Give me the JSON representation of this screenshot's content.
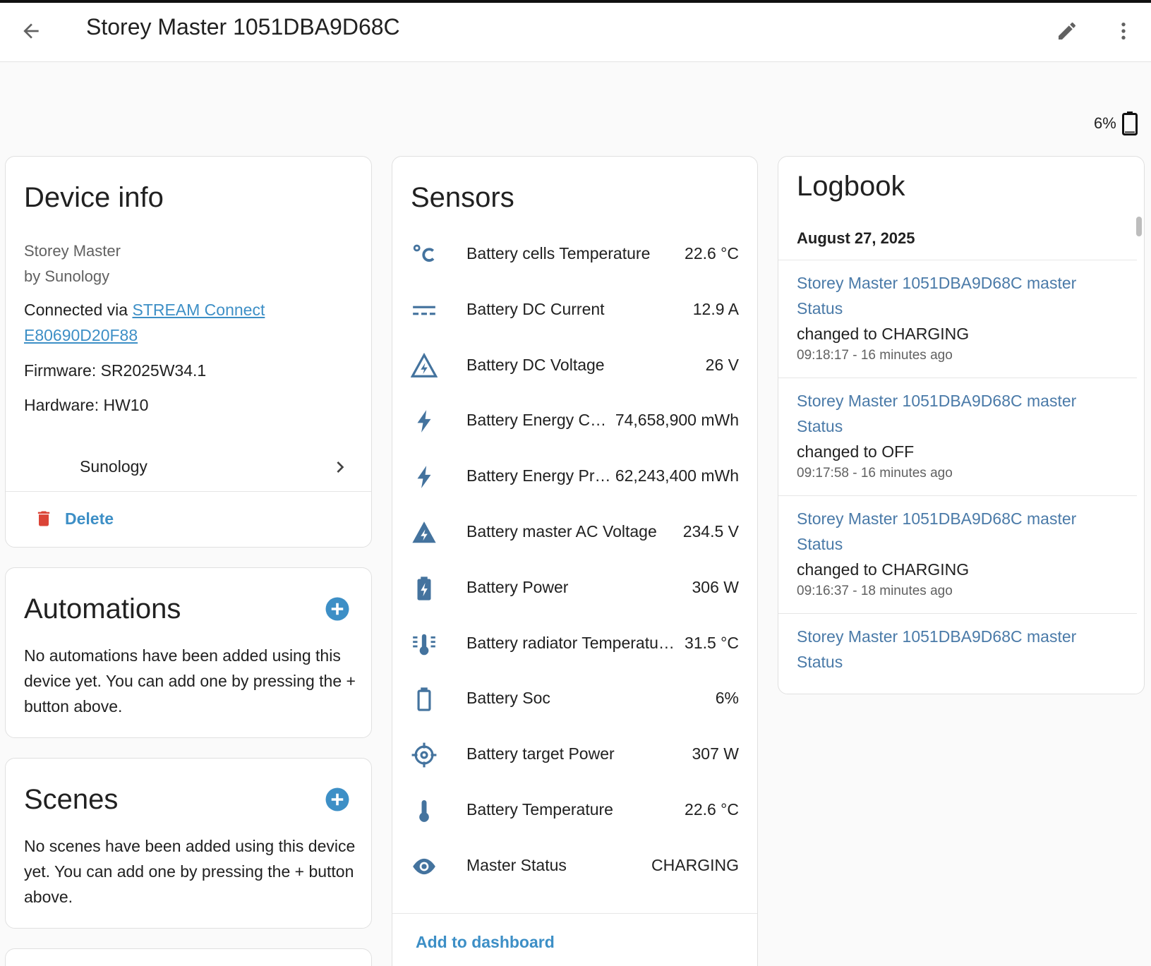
{
  "header": {
    "title": "Storey Master 1051DBA9D68C",
    "back_icon": "arrow-left-icon",
    "edit_icon": "pencil-icon",
    "more_icon": "dots-vertical-icon"
  },
  "battery_indicator": {
    "level_text": "6%",
    "level": 6,
    "icon": "battery-icon"
  },
  "device_info": {
    "title": "Device info",
    "model": "Storey Master",
    "manufacturer_line": "by Sunology",
    "connected_prefix": "Connected via",
    "connected_link_line1": "STREAM Connect",
    "connected_link_line2": "E80690D20F88",
    "firmware": "Firmware: SR2025W34.1",
    "hardware": "Hardware: HW10",
    "integration_label": "Sunology",
    "delete_label": "Delete"
  },
  "automations": {
    "title": "Automations",
    "body": "No automations have been added using this device yet. You can add one by pressing the + button above."
  },
  "scenes": {
    "title": "Scenes",
    "body": "No scenes have been added using this device yet. You can add one by pressing the + button above."
  },
  "sensors": {
    "title": "Sensors",
    "items": [
      {
        "name": "Battery cells Temperature",
        "value": "22.6 °C",
        "icon": "celsius-icon"
      },
      {
        "name": "Battery DC Current",
        "value": "12.9 A",
        "icon": "current-dc-icon"
      },
      {
        "name": "Battery DC Voltage",
        "value": "26 V",
        "icon": "flash-triangle-outline-icon"
      },
      {
        "name": "Battery Energy C…",
        "value": "74,658,900 mWh",
        "icon": "lightning-bolt-icon"
      },
      {
        "name": "Battery Energy Pr…",
        "value": "62,243,400 mWh",
        "icon": "lightning-bolt-icon"
      },
      {
        "name": "Battery master AC Voltage",
        "value": "234.5 V",
        "icon": "flash-triangle-icon"
      },
      {
        "name": "Battery Power",
        "value": "306 W",
        "icon": "battery-charging-icon"
      },
      {
        "name": "Battery radiator Temperatu…",
        "value": "31.5 °C",
        "icon": "thermometer-lines-icon"
      },
      {
        "name": "Battery Soc",
        "value": "6%",
        "icon": "battery-outline-icon"
      },
      {
        "name": "Battery target Power",
        "value": "307 W",
        "icon": "crosshairs-icon"
      },
      {
        "name": "Battery Temperature",
        "value": "22.6 °C",
        "icon": "thermometer-icon"
      },
      {
        "name": "Master Status",
        "value": "CHARGING",
        "icon": "eye-icon"
      }
    ],
    "add_to_dashboard": "Add to dashboard"
  },
  "logbook": {
    "title": "Logbook",
    "date": "August 27, 2025",
    "entries": [
      {
        "name": "Storey Master 1051DBA9D68C master Status",
        "change": "changed to CHARGING",
        "time": "09:18:17 - 16 minutes ago"
      },
      {
        "name": "Storey Master 1051DBA9D68C master Status",
        "change": "changed to OFF",
        "time": "09:17:58 - 16 minutes ago"
      },
      {
        "name": "Storey Master 1051DBA9D68C master Status",
        "change": "changed to CHARGING",
        "time": "09:16:37 - 18 minutes ago"
      },
      {
        "name": "Storey Master 1051DBA9D68C master Status",
        "change": "",
        "time": ""
      }
    ]
  },
  "colors": {
    "accent": "#3d8fc6",
    "icon": "#44739e",
    "delete": "#db4437",
    "logbook_link": "#4a7aa8"
  }
}
